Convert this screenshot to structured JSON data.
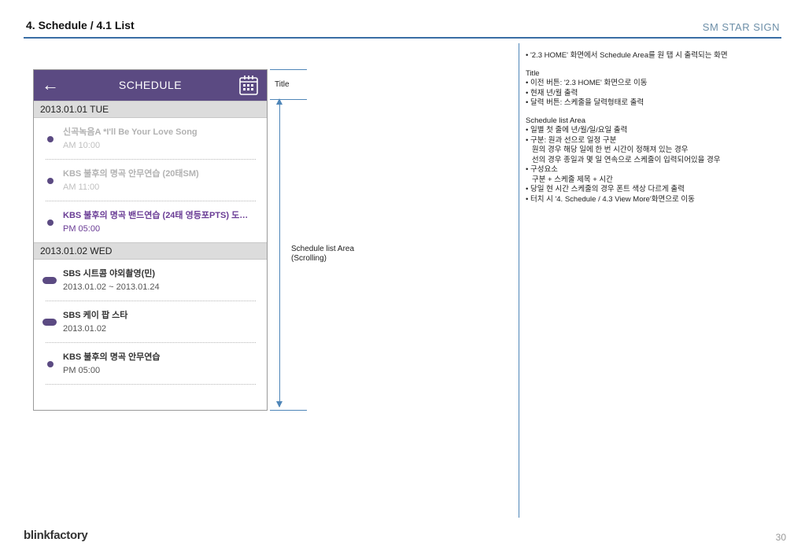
{
  "page": {
    "title": "4. Schedule / 4.1 List",
    "brand": "SM STAR SIGN",
    "footer_logo": "blinkfactory",
    "page_number": "30"
  },
  "colors": {
    "accent": "#5b4a82",
    "rule": "#3a6ea5",
    "highlight_text": "#6a3c95"
  },
  "app": {
    "title": "SCHEDULE",
    "back_icon": "arrow-left-icon",
    "calendar_icon": "calendar-icon",
    "sections": [
      {
        "date": "2013.01.01  TUE",
        "items": [
          {
            "mark": "dot",
            "state": "past",
            "title": "신곡녹음A *I'll Be Your Love Song",
            "time": "AM 10:00"
          },
          {
            "mark": "dot",
            "state": "past",
            "title": "KBS 불후의 명곡 안무연습 (20태SM)",
            "time": "AM 11:00"
          },
          {
            "mark": "dot",
            "state": "now",
            "title": "KBS 불후의 명곡 밴드연습 (24태 영등포PTS) 도시…",
            "time": "PM 05:00"
          }
        ]
      },
      {
        "date": "2013.01.02  WED",
        "items": [
          {
            "mark": "line",
            "state": "normal",
            "title": "SBS 시트콤 야외촬영(민)",
            "time": "2013.01.02 ~ 2013.01.24"
          },
          {
            "mark": "line",
            "state": "normal",
            "title": "SBS  케이 팝 스타",
            "time": "2013.01.02"
          },
          {
            "mark": "dot",
            "state": "normal",
            "title": "KBS 불후의 명곡 안무연습",
            "time": "PM 05:00"
          }
        ]
      }
    ]
  },
  "annotations": {
    "title_label": "Title",
    "list_label_1": "Schedule list Area",
    "list_label_2": "(Scrolling)"
  },
  "description": {
    "intro": "• '2.3 HOME' 화면에서 Schedule Area를 원 탭 시 출력되는 화면",
    "title_block": [
      "Title",
      "• 이전 버튼: '2.3 HOME' 화면으로 이동",
      "• 현재 년/월 출력",
      "• 달력 버튼: 스케줄을 달력형태로 출력"
    ],
    "list_block": [
      "Schedule list Area",
      "• 일별 첫 줄에 년/월/일/요일 출력",
      "• 구분: 원과 선으로 일정 구분",
      "   원의 경우 해당 일에 한 번 시간이 정해져 있는 경우",
      "   선의 경우 종일과 몇 일 연속으로 스케줄이 입력되어있을 경우",
      "• 구성요소",
      "   구분 + 스케줄 제목 + 시간",
      "• 당일 현 시간 스케줄의 경우 폰트 색상 다르게 출력",
      "• 터치 시 '4. Schedule / 4.3 View More'화면으로 이동"
    ]
  }
}
